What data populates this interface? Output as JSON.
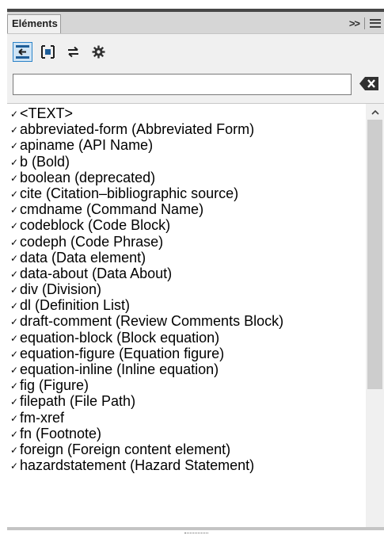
{
  "panel": {
    "tab_label": "Eléments",
    "expand_glyph": ">>"
  },
  "search": {
    "value": "",
    "placeholder": ""
  },
  "elements": [
    {
      "label": "<TEXT>"
    },
    {
      "label": "abbreviated-form  (Abbreviated Form)"
    },
    {
      "label": "apiname  (API Name)"
    },
    {
      "label": "b  (Bold)"
    },
    {
      "label": "boolean  (deprecated)"
    },
    {
      "label": "cite  (Citation–bibliographic source)"
    },
    {
      "label": "cmdname  (Command Name)"
    },
    {
      "label": "codeblock  (Code Block)"
    },
    {
      "label": "codeph  (Code Phrase)"
    },
    {
      "label": "data  (Data element)"
    },
    {
      "label": "data-about  (Data About)"
    },
    {
      "label": "div  (Division)"
    },
    {
      "label": "dl  (Definition List)"
    },
    {
      "label": "draft-comment  (Review Comments Block)"
    },
    {
      "label": "equation-block  (Block equation)"
    },
    {
      "label": "equation-figure  (Equation figure)"
    },
    {
      "label": "equation-inline  (Inline equation)"
    },
    {
      "label": "fig  (Figure)"
    },
    {
      "label": "filepath  (File Path)"
    },
    {
      "label": "fm-xref"
    },
    {
      "label": "fn  (Footnote)"
    },
    {
      "label": "foreign  (Foreign content element)"
    },
    {
      "label": "hazardstatement  (Hazard Statement)"
    }
  ],
  "check_glyph": "✓",
  "colors": {
    "accent": "#2d84c9",
    "panel_bg": "#f0f0f0",
    "tab_strip": "#d6d6d6"
  },
  "icons": [
    "insert-element-icon",
    "wrap-element-icon",
    "change-element-icon",
    "settings-gear-icon",
    "clear-search-icon",
    "chevron-up-icon",
    "panel-menu-icon"
  ]
}
